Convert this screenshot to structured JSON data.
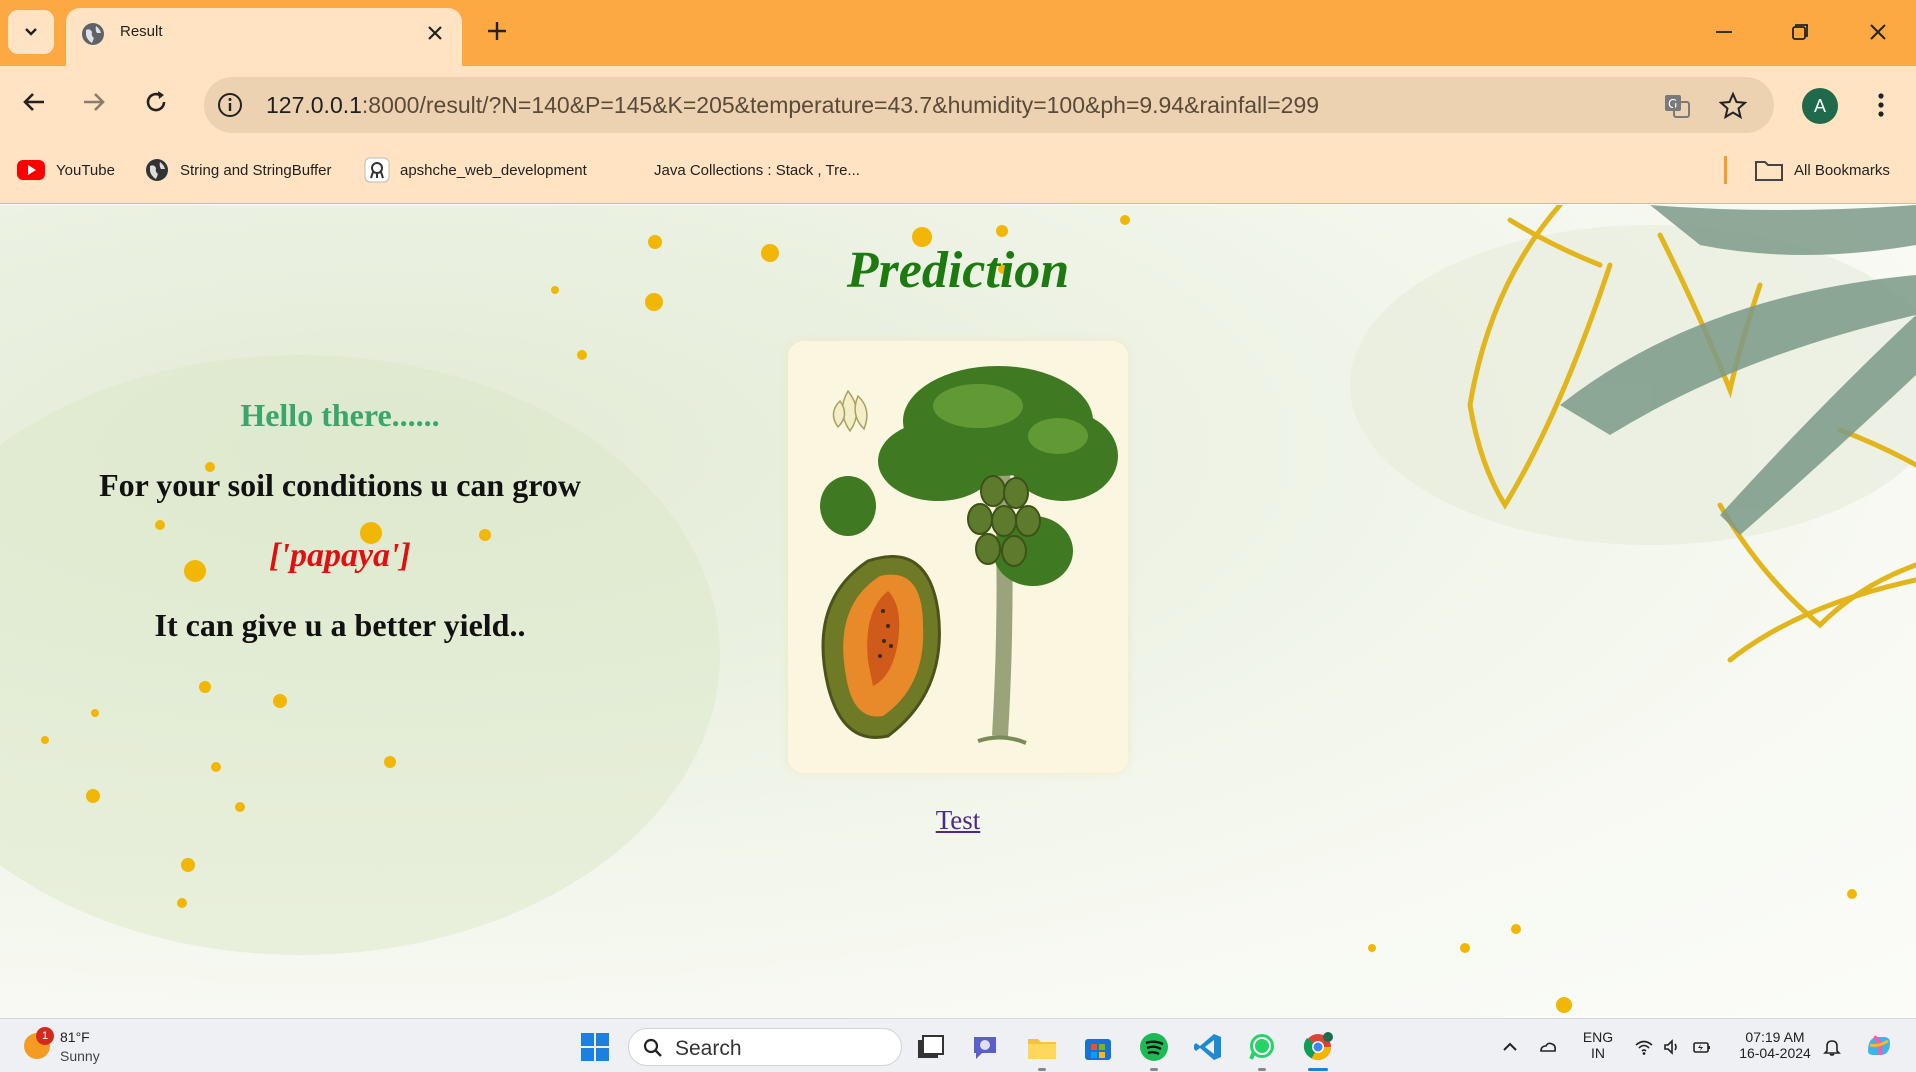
{
  "browser": {
    "tab_title": "Result",
    "url_host": "127.0.0.1",
    "url_rest": ":8000/result/?N=140&P=145&K=205&temperature=43.7&humidity=100&ph=9.94&rainfall=299",
    "profile_initial": "A",
    "bookmarks": [
      {
        "label": "YouTube",
        "icon": "youtube-icon"
      },
      {
        "label": "String and StringBuffer",
        "icon": "globe-icon"
      },
      {
        "label": "apshche_web_development",
        "icon": "github-icon"
      },
      {
        "label": "Java Collections : Stack , Tre...",
        "icon": "none"
      }
    ],
    "all_bookmarks_label": "All Bookmarks"
  },
  "page": {
    "title": "Prediction",
    "greeting": "Hello there......",
    "line1": "For your soil conditions u can grow",
    "crop": "['papaya']",
    "line2": "It can give u a better yield..",
    "test_link": "Test",
    "image_subject": "papaya tree botanical illustration"
  },
  "taskbar": {
    "weather_temp": "81°F",
    "weather_desc": "Sunny",
    "weather_badge": "1",
    "search_placeholder": "Search",
    "lang_line1": "ENG",
    "lang_line2": "IN",
    "time": "07:19 AM",
    "date": "16-04-2024"
  },
  "colors": {
    "tabstrip": "#fca944",
    "toolbar": "#ffe3c3",
    "title_green": "#1c7a10",
    "greeting_green": "#3aa66a",
    "crop_red": "#e01010",
    "link_purple": "#4b2a8a"
  }
}
